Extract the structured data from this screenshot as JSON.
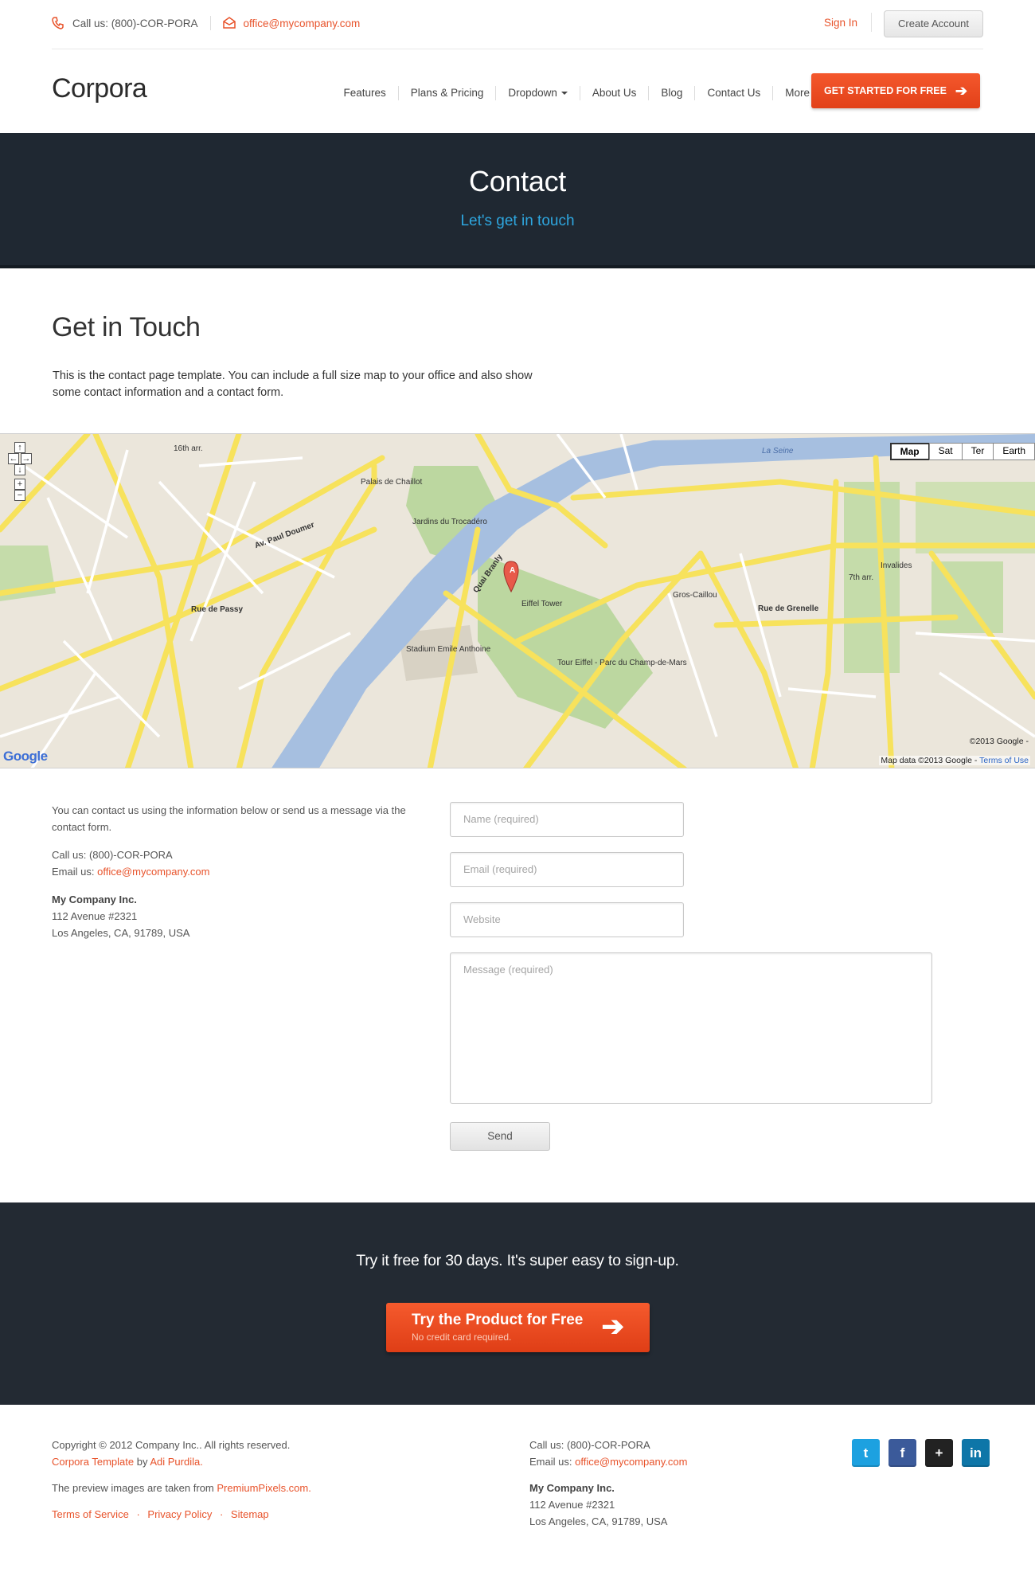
{
  "topbar": {
    "phone_label": "Call us: (800)-COR-PORA",
    "email": "office@mycompany.com",
    "sign_in": "Sign In",
    "create_account": "Create Account"
  },
  "header": {
    "logo": "Corpora",
    "nav": [
      {
        "label": "Features"
      },
      {
        "label": "Plans & Pricing"
      },
      {
        "label": "Dropdown",
        "has_caret": true
      },
      {
        "label": "About Us"
      },
      {
        "label": "Blog"
      },
      {
        "label": "Contact Us"
      },
      {
        "label": "More",
        "has_caret": true
      }
    ],
    "cta": "GET STARTED FOR FREE",
    "cta_icon": "arrow-right-icon"
  },
  "hero": {
    "title": "Contact",
    "subtitle": "Let's get in touch"
  },
  "intro": {
    "title": "Get in Touch",
    "text": "This is the contact page template. You can include a full size map to your office and also show some contact information and a contact form."
  },
  "map": {
    "type_buttons": [
      "Map",
      "Sat",
      "Ter",
      "Earth"
    ],
    "active_type": "Map",
    "copyright": "©2013 Google -",
    "data_text": "Map data ©2013 Google -",
    "terms": "Terms of Use",
    "google_logo": "Google",
    "labels": [
      "Palais de Chaillot",
      "Jardins du Trocadéro",
      "Eiffel Tower",
      "Tour Eiffel - Parc du Champ-de-Mars",
      "Stadium Emile Anthoine",
      "Gros-Caillou",
      "Invalides",
      "La Seine",
      "Av. Paul Doumer",
      "Rue de Passy",
      "Quai Branly",
      "Rue de Grenelle",
      "7th arr.",
      "16th arr."
    ],
    "marker": "A"
  },
  "contact": {
    "intro": "You can contact us using the information below or send us a message via the contact form.",
    "phone": "Call us: (800)-COR-PORA",
    "email_label": "Email us:",
    "email": "office@mycompany.com",
    "company": "My Company Inc.",
    "address1": "112 Avenue #2321",
    "address2": "Los Angeles, CA, 91789, USA"
  },
  "form": {
    "name_placeholder": "Name (required)",
    "email_placeholder": "Email (required)",
    "website_placeholder": "Website",
    "message_placeholder": "Message (required)",
    "send": "Send"
  },
  "trial": {
    "text": "Try it free for 30 days. It's super easy to sign-up.",
    "button_title": "Try the Product for Free",
    "button_sub": "No credit card required."
  },
  "footer": {
    "copyright": "Copyright © 2012 Company Inc.. All rights reserved.",
    "template_link": "Corpora Template",
    "by": "by",
    "author": "Adi Purdila.",
    "preview_text": "The preview images are taken from",
    "preview_link": "PremiumPixels.com.",
    "links": [
      "Terms of Service",
      "Privacy Policy",
      "Sitemap"
    ],
    "phone": "Call us: (800)-COR-PORA",
    "email_label": "Email us:",
    "email": "office@mycompany.com",
    "company": "My Company Inc.",
    "address1": "112 Avenue #2321",
    "address2": "Los Angeles, CA, 91789, USA",
    "socials": [
      {
        "name": "twitter-icon",
        "color": "#1da1e0"
      },
      {
        "name": "facebook-icon",
        "color": "#3b5a9a"
      },
      {
        "name": "google-plus-icon",
        "color": "#222222"
      },
      {
        "name": "linkedin-icon",
        "color": "#0e76a8"
      }
    ]
  },
  "colors": {
    "accent": "#e8532b",
    "hero_bg": "#1f2832",
    "hero_sub": "#2ea7e0"
  }
}
